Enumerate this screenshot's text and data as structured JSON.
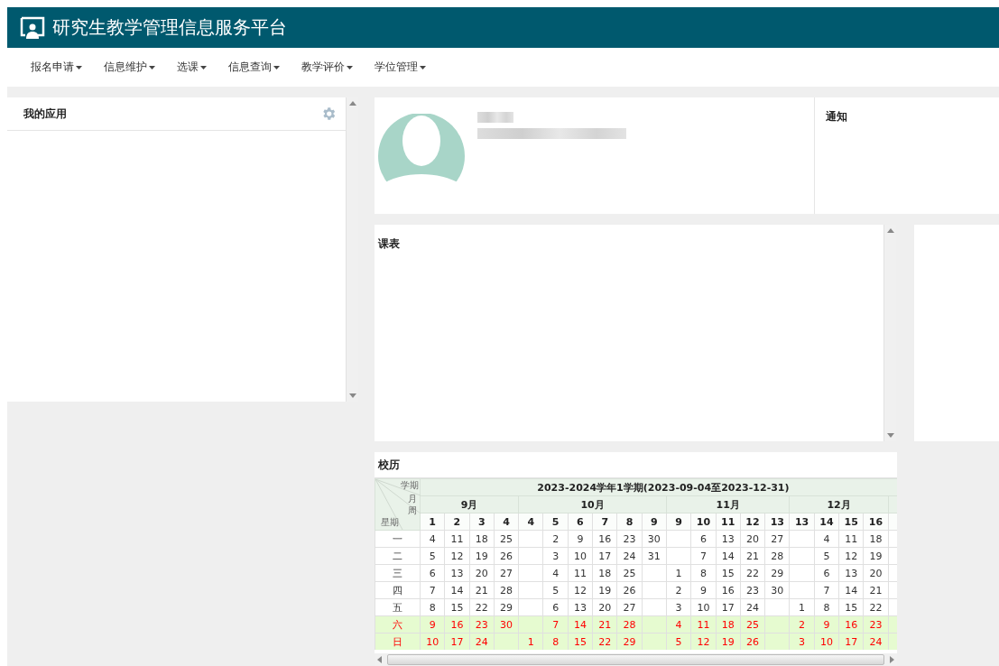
{
  "header": {
    "title": "研究生教学管理信息服务平台"
  },
  "nav": [
    {
      "label": "报名申请"
    },
    {
      "label": "信息维护"
    },
    {
      "label": "选课"
    },
    {
      "label": "信息查询"
    },
    {
      "label": "教学评价"
    },
    {
      "label": "学位管理"
    }
  ],
  "apps_panel": {
    "title": "我的应用"
  },
  "notice_panel": {
    "title": "通知"
  },
  "schedule_panel": {
    "title": "课表"
  },
  "calendar": {
    "title": "校历",
    "corner": [
      "学期",
      "月",
      "周",
      "星期"
    ],
    "term": "2023-2024学年1学期(2023-09-04至2023-12-31)",
    "months": [
      {
        "label": "9月",
        "weeks": [
          "1",
          "2",
          "3",
          "4"
        ]
      },
      {
        "label": "10月",
        "weeks": [
          "4",
          "5",
          "6",
          "7",
          "8",
          "9"
        ]
      },
      {
        "label": "11月",
        "weeks": [
          "9",
          "10",
          "11",
          "12",
          "13"
        ]
      },
      {
        "label": "12月",
        "weeks": [
          "13",
          "14",
          "15",
          "16"
        ]
      }
    ],
    "rows": [
      {
        "day": "一",
        "weekend": false,
        "cells": [
          "4",
          "11",
          "18",
          "25",
          null,
          "2",
          "9",
          "16",
          "23",
          "30",
          null,
          "6",
          "13",
          "20",
          "27",
          null,
          "4",
          "11",
          "18"
        ]
      },
      {
        "day": "二",
        "weekend": false,
        "cells": [
          "5",
          "12",
          "19",
          "26",
          null,
          "3",
          "10",
          "17",
          "24",
          "31",
          null,
          "7",
          "14",
          "21",
          "28",
          null,
          "5",
          "12",
          "19"
        ]
      },
      {
        "day": "三",
        "weekend": false,
        "cells": [
          "6",
          "13",
          "20",
          "27",
          null,
          "4",
          "11",
          "18",
          "25",
          null,
          "1",
          "8",
          "15",
          "22",
          "29",
          null,
          "6",
          "13",
          "20"
        ]
      },
      {
        "day": "四",
        "weekend": false,
        "cells": [
          "7",
          "14",
          "21",
          "28",
          null,
          "5",
          "12",
          "19",
          "26",
          null,
          "2",
          "9",
          "16",
          "23",
          "30",
          null,
          "7",
          "14",
          "21"
        ]
      },
      {
        "day": "五",
        "weekend": false,
        "cells": [
          "8",
          "15",
          "22",
          "29",
          null,
          "6",
          "13",
          "20",
          "27",
          null,
          "3",
          "10",
          "17",
          "24",
          null,
          "1",
          "8",
          "15",
          "22"
        ]
      },
      {
        "day": "六",
        "weekend": true,
        "cells": [
          "9",
          "16",
          "23",
          "30",
          null,
          "7",
          "14",
          "21",
          "28",
          null,
          "4",
          "11",
          "18",
          "25",
          null,
          "2",
          "9",
          "16",
          "23"
        ]
      },
      {
        "day": "日",
        "weekend": true,
        "cells": [
          "10",
          "17",
          "24",
          null,
          "1",
          "8",
          "15",
          "22",
          "29",
          null,
          "5",
          "12",
          "19",
          "26",
          null,
          "3",
          "10",
          "17",
          "24"
        ]
      }
    ]
  }
}
